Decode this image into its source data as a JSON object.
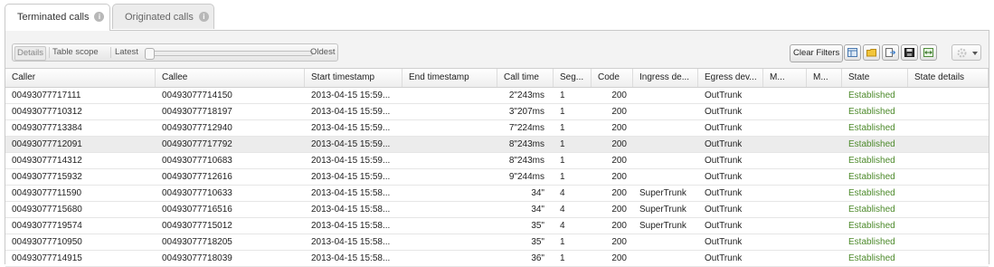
{
  "tabs": [
    {
      "label": "Terminated calls"
    },
    {
      "label": "Originated calls"
    }
  ],
  "toolbar": {
    "details_label": "Details",
    "scope_label": "Table scope",
    "latest_label": "Latest",
    "oldest_label": "Oldest",
    "slider_position": 0,
    "clear_filters_label": "Clear Filters"
  },
  "columns": [
    "Caller",
    "Callee",
    "Start timestamp",
    "End timestamp",
    "Call time",
    "Seg...",
    "Code",
    "Ingress de...",
    "Egress dev...",
    "M...",
    "M...",
    "State",
    "State details"
  ],
  "rows": [
    {
      "caller": "00493077717111",
      "callee": "00493077714150",
      "start": "2013-04-15 15:59...",
      "end": "",
      "call_time": "2\"243ms",
      "seg": "1",
      "code": "200",
      "ingress": "",
      "egress": "OutTrunk",
      "m1": "",
      "m2": "",
      "state": "Established",
      "details": ""
    },
    {
      "caller": "00493077710312",
      "callee": "00493077718197",
      "start": "2013-04-15 15:59...",
      "end": "",
      "call_time": "3\"207ms",
      "seg": "1",
      "code": "200",
      "ingress": "",
      "egress": "OutTrunk",
      "m1": "",
      "m2": "",
      "state": "Established",
      "details": ""
    },
    {
      "caller": "00493077713384",
      "callee": "00493077712940",
      "start": "2013-04-15 15:59...",
      "end": "",
      "call_time": "7\"224ms",
      "seg": "1",
      "code": "200",
      "ingress": "",
      "egress": "OutTrunk",
      "m1": "",
      "m2": "",
      "state": "Established",
      "details": ""
    },
    {
      "caller": "00493077712091",
      "callee": "00493077717792",
      "start": "2013-04-15 15:59...",
      "end": "",
      "call_time": "8\"243ms",
      "seg": "1",
      "code": "200",
      "ingress": "",
      "egress": "OutTrunk",
      "m1": "",
      "m2": "",
      "state": "Established",
      "details": "",
      "selected": true
    },
    {
      "caller": "00493077714312",
      "callee": "00493077710683",
      "start": "2013-04-15 15:59...",
      "end": "",
      "call_time": "8\"243ms",
      "seg": "1",
      "code": "200",
      "ingress": "",
      "egress": "OutTrunk",
      "m1": "",
      "m2": "",
      "state": "Established",
      "details": ""
    },
    {
      "caller": "00493077715932",
      "callee": "00493077712616",
      "start": "2013-04-15 15:59...",
      "end": "",
      "call_time": "9\"244ms",
      "seg": "1",
      "code": "200",
      "ingress": "",
      "egress": "OutTrunk",
      "m1": "",
      "m2": "",
      "state": "Established",
      "details": ""
    },
    {
      "caller": "00493077711590",
      "callee": "00493077710633",
      "start": "2013-04-15 15:58...",
      "end": "",
      "call_time": "34\"",
      "seg": "4",
      "code": "200",
      "ingress": "SuperTrunk",
      "egress": "OutTrunk",
      "m1": "",
      "m2": "",
      "state": "Established",
      "details": ""
    },
    {
      "caller": "00493077715680",
      "callee": "00493077716516",
      "start": "2013-04-15 15:58...",
      "end": "",
      "call_time": "34\"",
      "seg": "4",
      "code": "200",
      "ingress": "SuperTrunk",
      "egress": "OutTrunk",
      "m1": "",
      "m2": "",
      "state": "Established",
      "details": ""
    },
    {
      "caller": "00493077719574",
      "callee": "00493077715012",
      "start": "2013-04-15 15:58...",
      "end": "",
      "call_time": "35\"",
      "seg": "4",
      "code": "200",
      "ingress": "SuperTrunk",
      "egress": "OutTrunk",
      "m1": "",
      "m2": "",
      "state": "Established",
      "details": ""
    },
    {
      "caller": "00493077710950",
      "callee": "00493077718205",
      "start": "2013-04-15 15:58...",
      "end": "",
      "call_time": "35\"",
      "seg": "1",
      "code": "200",
      "ingress": "",
      "egress": "OutTrunk",
      "m1": "",
      "m2": "",
      "state": "Established",
      "details": ""
    },
    {
      "caller": "00493077714915",
      "callee": "00493077718039",
      "start": "2013-04-15 15:58...",
      "end": "",
      "call_time": "36\"",
      "seg": "1",
      "code": "200",
      "ingress": "",
      "egress": "OutTrunk",
      "m1": "",
      "m2": "",
      "state": "Established",
      "details": ""
    }
  ],
  "colors": {
    "state_established": "#4d8a2b",
    "selected_row": "#ececec"
  }
}
